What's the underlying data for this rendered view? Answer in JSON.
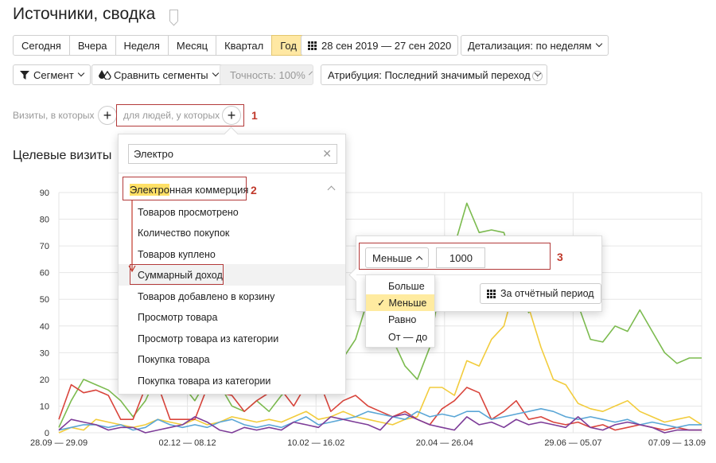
{
  "page": {
    "title": "Источники, сводка"
  },
  "periods": [
    {
      "label": "Сегодня",
      "active": false
    },
    {
      "label": "Вчера",
      "active": false
    },
    {
      "label": "Неделя",
      "active": false
    },
    {
      "label": "Месяц",
      "active": false
    },
    {
      "label": "Квартал",
      "active": false
    },
    {
      "label": "Год",
      "active": true
    }
  ],
  "date_range": "28 сен 2019 — 27 сен 2020",
  "detail": "Детализация: по неделям",
  "toolbar": {
    "segment": "Сегмент",
    "compare": "Сравнить сегменты",
    "accuracy": "Точность: 100%",
    "attribution": "Атрибуция: Последний значимый переход",
    "help": "?"
  },
  "filter": {
    "visits_label": "Визиты, в которых",
    "people_label": "для людей, у которых",
    "plus": "+",
    "markers": [
      "1",
      "2",
      "3"
    ]
  },
  "chart_title": "Целевые визиты",
  "dropdown": {
    "search_value": "Электро",
    "clear": "✕",
    "group_highlight": "Электро",
    "group_rest": "нная коммерция",
    "items": [
      "Товаров просмотрено",
      "Количество покупок",
      "Товаров куплено",
      "Суммарный доход",
      "Товаров добавлено в корзину",
      "Просмотр товара",
      "Просмотр товара из категории",
      "Покупка товара",
      "Покупка товара из категории"
    ]
  },
  "condition": {
    "operator": "Меньше",
    "value": "1000",
    "period_button": "За отчётный период",
    "options": [
      "Больше",
      "Меньше",
      "Равно",
      "От — до"
    ],
    "selected": "Меньше",
    "check": "✓"
  },
  "colors": {
    "green": "#7cbb4f",
    "yellow": "#f2cc3c",
    "red": "#d9453c",
    "blue": "#5aa6d6",
    "purple": "#7d3c98",
    "grid": "#e6e6e6",
    "marker": "#c0392b"
  },
  "chart_data": {
    "type": "line",
    "x_labels": [
      "28.09 — 29.09",
      "02.12 — 08.12",
      "10.02 — 16.02",
      "20.04 — 26.04",
      "29.06 — 05.07",
      "07.09 — 13.09"
    ],
    "yticks": [
      0,
      10,
      20,
      30,
      40,
      50,
      60,
      70,
      80,
      90
    ],
    "ylim": [
      0,
      90
    ],
    "grid": true,
    "series": [
      {
        "color": "#7cbb4f",
        "values": [
          2,
          12,
          20,
          18,
          16,
          12,
          6,
          12,
          22,
          20,
          18,
          12,
          20,
          18,
          10,
          8,
          12,
          8,
          14,
          18,
          22,
          20,
          24,
          28,
          35,
          50,
          40,
          35,
          25,
          20,
          32,
          60,
          70,
          86,
          75,
          76,
          75,
          60,
          45,
          55,
          50,
          58,
          48,
          35,
          34,
          40,
          38,
          46,
          38,
          30,
          26,
          28,
          28
        ]
      },
      {
        "color": "#f2cc3c",
        "values": [
          0,
          2,
          1,
          5,
          4,
          3,
          2,
          3,
          5,
          4,
          3,
          5,
          3,
          4,
          6,
          5,
          4,
          5,
          4,
          6,
          8,
          5,
          6,
          8,
          6,
          5,
          4,
          3,
          5,
          6,
          17,
          17,
          14,
          27,
          25,
          35,
          40,
          57,
          47,
          32,
          20,
          18,
          11,
          9,
          8,
          10,
          12,
          8,
          6,
          4,
          5,
          6,
          3
        ]
      },
      {
        "color": "#d9453c",
        "values": [
          5,
          18,
          15,
          16,
          14,
          5,
          5,
          17,
          18,
          5,
          5,
          5,
          17,
          15,
          14,
          8,
          12,
          15,
          16,
          10,
          18,
          20,
          8,
          12,
          14,
          10,
          8,
          6,
          8,
          5,
          3,
          9,
          12,
          17,
          15,
          5,
          8,
          12,
          5,
          6,
          4,
          3,
          4,
          2,
          3,
          1,
          2,
          3,
          2,
          1,
          2,
          1,
          1
        ]
      },
      {
        "color": "#5aa6d6",
        "values": [
          1,
          2,
          3,
          3,
          2,
          3,
          1,
          2,
          5,
          3,
          2,
          3,
          2,
          4,
          5,
          3,
          2,
          3,
          2,
          4,
          6,
          3,
          4,
          5,
          6,
          8,
          7,
          6,
          5,
          8,
          6,
          7,
          6,
          8,
          8,
          5,
          6,
          7,
          8,
          9,
          8,
          6,
          5,
          6,
          5,
          4,
          5,
          3,
          4,
          3,
          2,
          3,
          3
        ]
      },
      {
        "color": "#7d3c98",
        "values": [
          1,
          5,
          4,
          3,
          1,
          2,
          2,
          0,
          1,
          2,
          3,
          6,
          4,
          1,
          0,
          2,
          1,
          2,
          1,
          4,
          3,
          2,
          6,
          5,
          4,
          3,
          1,
          6,
          7,
          5,
          3,
          2,
          1,
          6,
          3,
          4,
          2,
          5,
          3,
          4,
          3,
          2,
          6,
          2,
          1,
          3,
          4,
          3,
          2,
          0,
          1,
          1,
          1
        ]
      }
    ]
  }
}
